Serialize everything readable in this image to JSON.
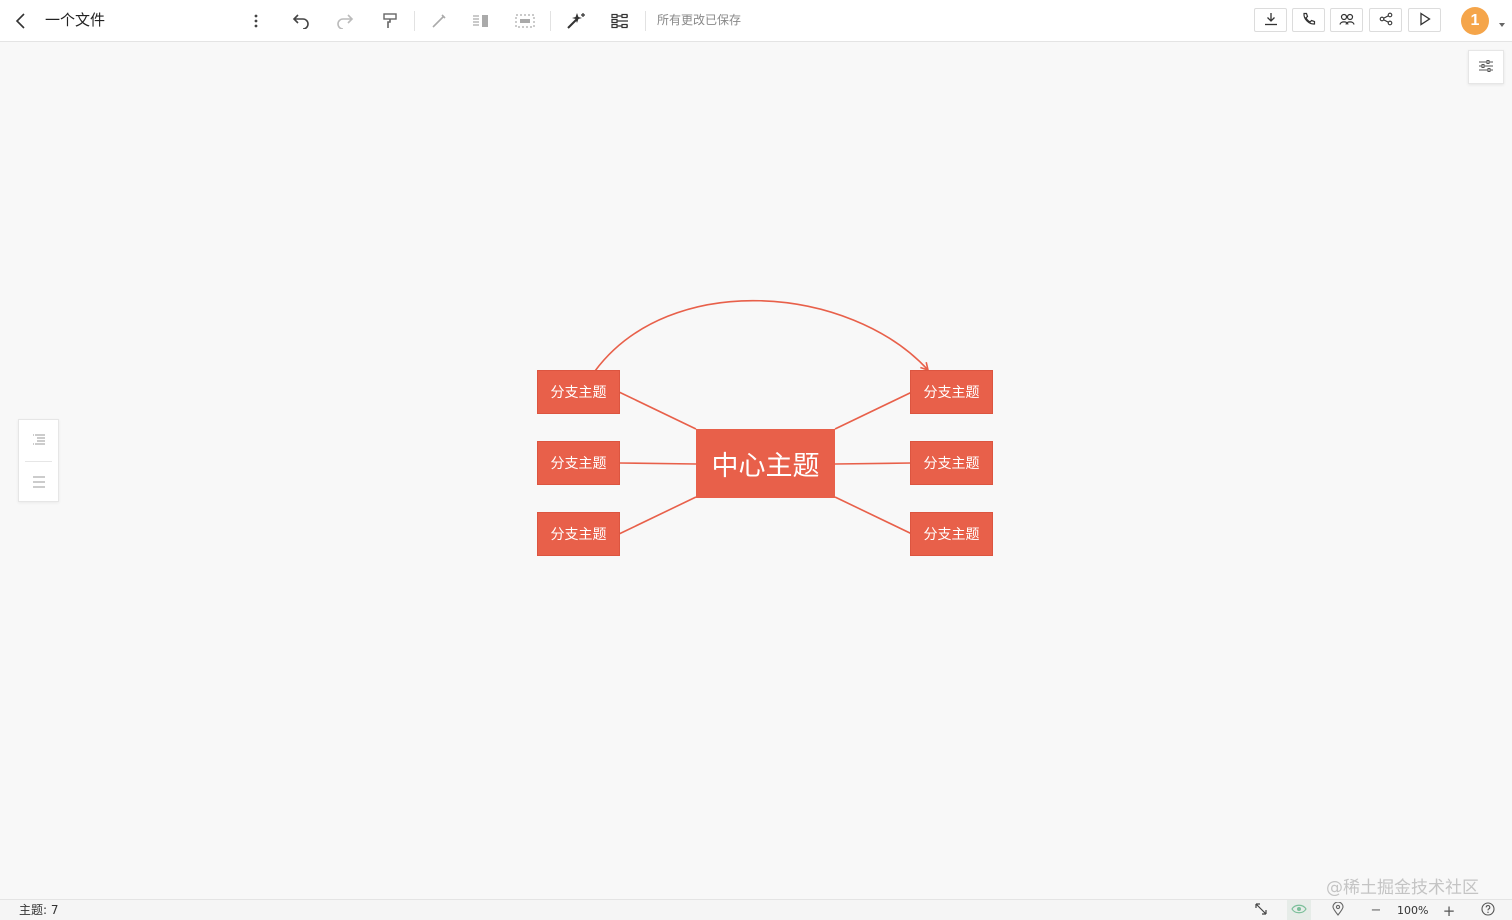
{
  "header": {
    "back_icon": "chevron-left-icon",
    "doc_title": "一个文件",
    "toolbar_icons": [
      "more-vertical-icon",
      "undo-icon",
      "redo-icon",
      "format-painter-icon",
      "pen-icon",
      "align-icon",
      "selection-frame-icon",
      "magic-wand-icon",
      "layout-icon"
    ],
    "save_status": "所有更改已保存",
    "right_buttons": [
      "download-icon",
      "phone-icon",
      "collaborators-icon",
      "share-icon",
      "play-icon"
    ],
    "avatar_label": "1"
  },
  "mindmap": {
    "center_topic": "中心主题",
    "branches": [
      "分支主题",
      "分支主题",
      "分支主题",
      "分支主题",
      "分支主题",
      "分支主题"
    ],
    "accent_color": "#e8604a"
  },
  "statusbar": {
    "topic_label": "主题",
    "separator": ":",
    "topic_count": "7",
    "zoom": "100%",
    "zoom_out": "−",
    "zoom_in": "+"
  },
  "watermark": "@稀土掘金技术社区"
}
